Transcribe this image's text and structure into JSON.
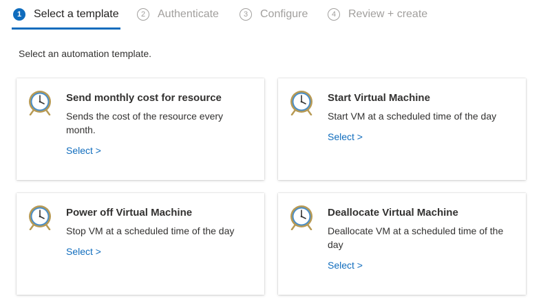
{
  "steps": [
    {
      "number": "1",
      "label": "Select a template",
      "active": true
    },
    {
      "number": "2",
      "label": "Authenticate",
      "active": false
    },
    {
      "number": "3",
      "label": "Configure",
      "active": false
    },
    {
      "number": "4",
      "label": "Review + create",
      "active": false
    }
  ],
  "instructions": "Select an automation template.",
  "templates": [
    {
      "title": "Send monthly cost for resource",
      "description": "Sends the cost of the resource every month.",
      "select_label": "Select >",
      "icon": "clock-icon"
    },
    {
      "title": "Start Virtual Machine",
      "description": "Start VM at a scheduled time of the day",
      "select_label": "Select >",
      "icon": "clock-icon"
    },
    {
      "title": "Power off Virtual Machine",
      "description": "Stop VM at a scheduled time of the day",
      "select_label": "Select >",
      "icon": "clock-icon"
    },
    {
      "title": "Deallocate Virtual Machine",
      "description": "Deallocate VM at a scheduled time of the day",
      "select_label": "Select >",
      "icon": "clock-icon"
    }
  ],
  "colors": {
    "accent": "#0f6cbd",
    "inactive": "#a19f9d",
    "text": "#323130",
    "clock_frame": "#b89a54",
    "clock_face": "#ffffff",
    "clock_ring": "#4a8ec8"
  }
}
